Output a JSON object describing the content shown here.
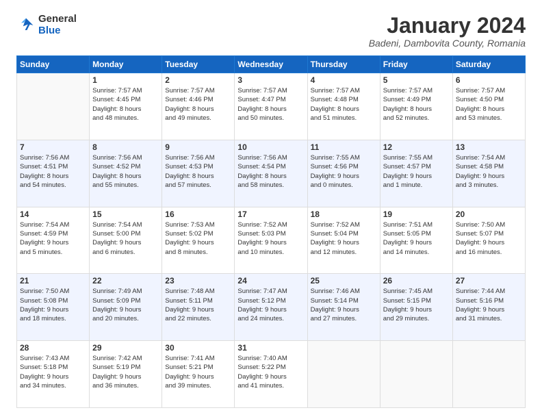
{
  "header": {
    "logo": {
      "general": "General",
      "blue": "Blue"
    },
    "title": "January 2024",
    "location": "Badeni, Dambovita County, Romania"
  },
  "calendar": {
    "days_of_week": [
      "Sunday",
      "Monday",
      "Tuesday",
      "Wednesday",
      "Thursday",
      "Friday",
      "Saturday"
    ],
    "weeks": [
      [
        {
          "day": "",
          "info": ""
        },
        {
          "day": "1",
          "info": "Sunrise: 7:57 AM\nSunset: 4:45 PM\nDaylight: 8 hours\nand 48 minutes."
        },
        {
          "day": "2",
          "info": "Sunrise: 7:57 AM\nSunset: 4:46 PM\nDaylight: 8 hours\nand 49 minutes."
        },
        {
          "day": "3",
          "info": "Sunrise: 7:57 AM\nSunset: 4:47 PM\nDaylight: 8 hours\nand 50 minutes."
        },
        {
          "day": "4",
          "info": "Sunrise: 7:57 AM\nSunset: 4:48 PM\nDaylight: 8 hours\nand 51 minutes."
        },
        {
          "day": "5",
          "info": "Sunrise: 7:57 AM\nSunset: 4:49 PM\nDaylight: 8 hours\nand 52 minutes."
        },
        {
          "day": "6",
          "info": "Sunrise: 7:57 AM\nSunset: 4:50 PM\nDaylight: 8 hours\nand 53 minutes."
        }
      ],
      [
        {
          "day": "7",
          "info": "Sunrise: 7:56 AM\nSunset: 4:51 PM\nDaylight: 8 hours\nand 54 minutes."
        },
        {
          "day": "8",
          "info": "Sunrise: 7:56 AM\nSunset: 4:52 PM\nDaylight: 8 hours\nand 55 minutes."
        },
        {
          "day": "9",
          "info": "Sunrise: 7:56 AM\nSunset: 4:53 PM\nDaylight: 8 hours\nand 57 minutes."
        },
        {
          "day": "10",
          "info": "Sunrise: 7:56 AM\nSunset: 4:54 PM\nDaylight: 8 hours\nand 58 minutes."
        },
        {
          "day": "11",
          "info": "Sunrise: 7:55 AM\nSunset: 4:56 PM\nDaylight: 9 hours\nand 0 minutes."
        },
        {
          "day": "12",
          "info": "Sunrise: 7:55 AM\nSunset: 4:57 PM\nDaylight: 9 hours\nand 1 minute."
        },
        {
          "day": "13",
          "info": "Sunrise: 7:54 AM\nSunset: 4:58 PM\nDaylight: 9 hours\nand 3 minutes."
        }
      ],
      [
        {
          "day": "14",
          "info": "Sunrise: 7:54 AM\nSunset: 4:59 PM\nDaylight: 9 hours\nand 5 minutes."
        },
        {
          "day": "15",
          "info": "Sunrise: 7:54 AM\nSunset: 5:00 PM\nDaylight: 9 hours\nand 6 minutes."
        },
        {
          "day": "16",
          "info": "Sunrise: 7:53 AM\nSunset: 5:02 PM\nDaylight: 9 hours\nand 8 minutes."
        },
        {
          "day": "17",
          "info": "Sunrise: 7:52 AM\nSunset: 5:03 PM\nDaylight: 9 hours\nand 10 minutes."
        },
        {
          "day": "18",
          "info": "Sunrise: 7:52 AM\nSunset: 5:04 PM\nDaylight: 9 hours\nand 12 minutes."
        },
        {
          "day": "19",
          "info": "Sunrise: 7:51 AM\nSunset: 5:05 PM\nDaylight: 9 hours\nand 14 minutes."
        },
        {
          "day": "20",
          "info": "Sunrise: 7:50 AM\nSunset: 5:07 PM\nDaylight: 9 hours\nand 16 minutes."
        }
      ],
      [
        {
          "day": "21",
          "info": "Sunrise: 7:50 AM\nSunset: 5:08 PM\nDaylight: 9 hours\nand 18 minutes."
        },
        {
          "day": "22",
          "info": "Sunrise: 7:49 AM\nSunset: 5:09 PM\nDaylight: 9 hours\nand 20 minutes."
        },
        {
          "day": "23",
          "info": "Sunrise: 7:48 AM\nSunset: 5:11 PM\nDaylight: 9 hours\nand 22 minutes."
        },
        {
          "day": "24",
          "info": "Sunrise: 7:47 AM\nSunset: 5:12 PM\nDaylight: 9 hours\nand 24 minutes."
        },
        {
          "day": "25",
          "info": "Sunrise: 7:46 AM\nSunset: 5:14 PM\nDaylight: 9 hours\nand 27 minutes."
        },
        {
          "day": "26",
          "info": "Sunrise: 7:45 AM\nSunset: 5:15 PM\nDaylight: 9 hours\nand 29 minutes."
        },
        {
          "day": "27",
          "info": "Sunrise: 7:44 AM\nSunset: 5:16 PM\nDaylight: 9 hours\nand 31 minutes."
        }
      ],
      [
        {
          "day": "28",
          "info": "Sunrise: 7:43 AM\nSunset: 5:18 PM\nDaylight: 9 hours\nand 34 minutes."
        },
        {
          "day": "29",
          "info": "Sunrise: 7:42 AM\nSunset: 5:19 PM\nDaylight: 9 hours\nand 36 minutes."
        },
        {
          "day": "30",
          "info": "Sunrise: 7:41 AM\nSunset: 5:21 PM\nDaylight: 9 hours\nand 39 minutes."
        },
        {
          "day": "31",
          "info": "Sunrise: 7:40 AM\nSunset: 5:22 PM\nDaylight: 9 hours\nand 41 minutes."
        },
        {
          "day": "",
          "info": ""
        },
        {
          "day": "",
          "info": ""
        },
        {
          "day": "",
          "info": ""
        }
      ]
    ]
  }
}
